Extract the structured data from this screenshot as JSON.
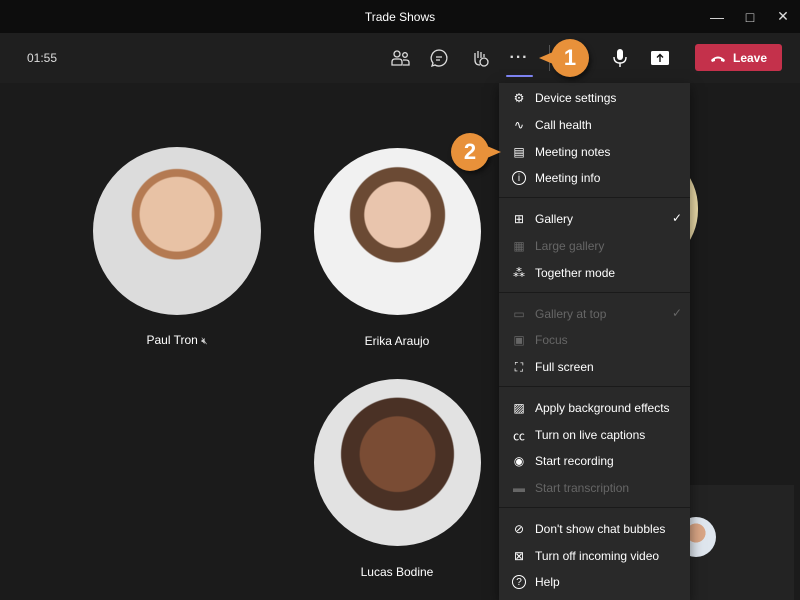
{
  "window": {
    "title": "Trade Shows"
  },
  "toolbar": {
    "timer": "01:55",
    "leave_label": "Leave",
    "accent": "#7f85f5",
    "leave_color": "#c4314b"
  },
  "participants": [
    {
      "name": "Paul Tron",
      "muted": true
    },
    {
      "name": "Erika Araujo"
    },
    {
      "name": "Lucas Bodine"
    }
  ],
  "menu": {
    "items": [
      {
        "label": "Device settings",
        "icon": "gear-icon"
      },
      {
        "label": "Call health",
        "icon": "pulse-icon"
      },
      {
        "label": "Meeting notes",
        "icon": "notes-icon"
      },
      {
        "label": "Meeting info",
        "icon": "info-icon"
      },
      {
        "label": "Gallery",
        "icon": "gallery-icon",
        "checked": true
      },
      {
        "label": "Large gallery",
        "icon": "large-gallery-icon",
        "disabled": true
      },
      {
        "label": "Together mode",
        "icon": "together-mode-icon"
      },
      {
        "label": "Gallery at top",
        "icon": "gallery-top-icon",
        "disabled": true,
        "checked": true
      },
      {
        "label": "Focus",
        "icon": "focus-icon",
        "disabled": true
      },
      {
        "label": "Full screen",
        "icon": "fullscreen-icon"
      },
      {
        "label": "Apply background effects",
        "icon": "background-effects-icon"
      },
      {
        "label": "Turn on live captions",
        "icon": "captions-icon"
      },
      {
        "label": "Start recording",
        "icon": "record-icon"
      },
      {
        "label": "Start transcription",
        "icon": "transcription-icon",
        "disabled": true
      },
      {
        "label": "Don't show chat bubbles",
        "icon": "chat-bubbles-off-icon"
      },
      {
        "label": "Turn off incoming video",
        "icon": "video-off-icon"
      },
      {
        "label": "Help",
        "icon": "help-icon"
      }
    ]
  },
  "callouts": [
    {
      "number": "1"
    },
    {
      "number": "2"
    }
  ],
  "callout_color": "#e8913a"
}
